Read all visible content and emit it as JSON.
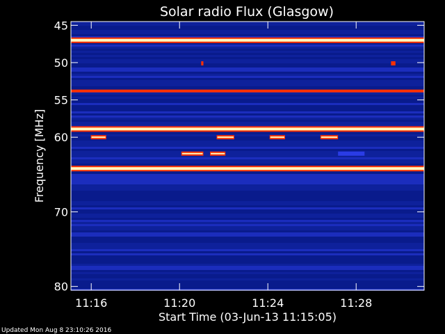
{
  "chart_data": {
    "type": "heatmap",
    "title": "Solar radio Flux (Glasgow)",
    "xlabel": "Start Time (03-Jun-13 11:15:05)",
    "ylabel": "Frequency [MHz]",
    "x_unit": "minutes after 11:15:05",
    "x_range": [
      0,
      16
    ],
    "y_range": [
      44.5,
      80.5
    ],
    "y_inverted": true,
    "x_ticks": [
      {
        "label": "11:16",
        "value": 0.92
      },
      {
        "label": "11:20",
        "value": 4.92
      },
      {
        "label": "11:24",
        "value": 8.92
      },
      {
        "label": "11:28",
        "value": 12.92
      }
    ],
    "y_ticks": [
      {
        "label": "45",
        "value": 45
      },
      {
        "label": "50",
        "value": 50
      },
      {
        "label": "55",
        "value": 55
      },
      {
        "label": "60",
        "value": 60
      },
      {
        "label": "70",
        "value": 70
      },
      {
        "label": "80",
        "value": 80
      }
    ],
    "colors": {
      "background": "#000000",
      "low": "#0a1c8c",
      "mid": "#2a3ce6",
      "high": "#ff3000",
      "max": "#fff8c0"
    },
    "continuous_bands": [
      {
        "frequency": 47.0,
        "intensity": "max"
      },
      {
        "frequency": 53.8,
        "intensity": "high"
      },
      {
        "frequency": 58.9,
        "intensity": "max"
      },
      {
        "frequency": 64.2,
        "intensity": "max"
      }
    ],
    "bursts": [
      {
        "frequency": 60.0,
        "t_start": 0.9,
        "t_end": 1.6,
        "intensity": "high"
      },
      {
        "frequency": 60.0,
        "t_start": 6.6,
        "t_end": 7.4,
        "intensity": "high"
      },
      {
        "frequency": 60.0,
        "t_start": 9.0,
        "t_end": 9.7,
        "intensity": "high"
      },
      {
        "frequency": 60.0,
        "t_start": 11.3,
        "t_end": 12.1,
        "intensity": "high"
      },
      {
        "frequency": 50.1,
        "t_start": 5.9,
        "t_end": 6.0,
        "intensity": "high"
      },
      {
        "frequency": 50.1,
        "t_start": 14.5,
        "t_end": 14.7,
        "intensity": "high"
      },
      {
        "frequency": 62.2,
        "t_start": 5.0,
        "t_end": 6.0,
        "intensity": "high"
      },
      {
        "frequency": 62.2,
        "t_start": 6.3,
        "t_end": 7.0,
        "intensity": "high"
      },
      {
        "frequency": 62.2,
        "t_start": 12.1,
        "t_end": 13.3,
        "intensity": "mid"
      }
    ]
  },
  "footer": {
    "updated": "Updated Mon Aug  8 23:10:26 2016"
  }
}
